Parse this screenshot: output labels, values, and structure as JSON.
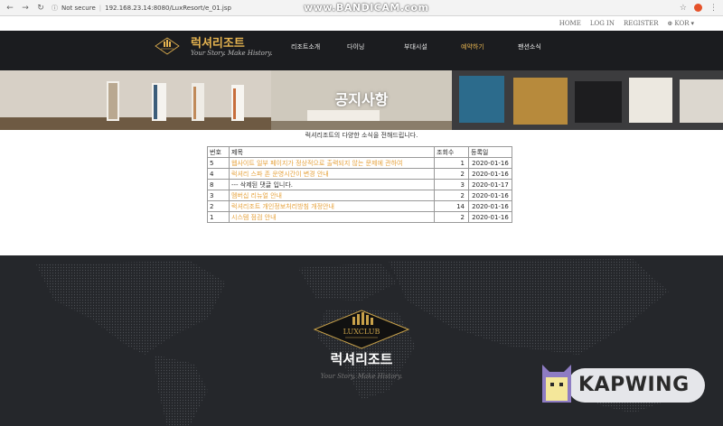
{
  "browser": {
    "security": "Not secure",
    "url": "192.168.23.14:8080/LuxResort/e_01.jsp",
    "recorder_watermark": "www.BANDICAM.com"
  },
  "utility_nav": {
    "home": "HOME",
    "login": "LOG IN",
    "register": "REGISTER",
    "language": "KOR"
  },
  "header": {
    "brand": "럭셔리조트",
    "tagline": "Your Story. Make History.",
    "menu": [
      "리조트소개",
      "다이닝",
      "부대시설",
      "예약하기",
      "팬션소식"
    ],
    "active_index": 3
  },
  "hero": {
    "title": "공지사항"
  },
  "notice": {
    "intro": "럭셔리조트의 다양한 소식을 전해드립니다.",
    "columns": [
      "번호",
      "제목",
      "조회수",
      "등록일"
    ],
    "rows": [
      {
        "num": "5",
        "title": "웹사이트 일부 페이지가 정상적으로 출력되지 않는 문제에 관하여",
        "views": "1",
        "date": "2020-01-16",
        "deleted": false
      },
      {
        "num": "4",
        "title": "럭셔리 스파 존 운영시간이 변경 안내",
        "views": "2",
        "date": "2020-01-16",
        "deleted": false
      },
      {
        "num": "8",
        "title": "--- 삭제된 댓글 입니다.",
        "views": "3",
        "date": "2020-01-17",
        "deleted": true
      },
      {
        "num": "3",
        "title": "멤버십 리뉴얼 안내",
        "views": "2",
        "date": "2020-01-16",
        "deleted": false
      },
      {
        "num": "2",
        "title": "럭셔리조트 개인정보처리방침 개정안내",
        "views": "14",
        "date": "2020-01-16",
        "deleted": false
      },
      {
        "num": "1",
        "title": "시스템 점검 안내",
        "views": "2",
        "date": "2020-01-16",
        "deleted": false
      }
    ]
  },
  "footer": {
    "logo_text": "LUXCLUB",
    "brand": "럭셔리조트",
    "tagline": "Your Story. Make History."
  },
  "watermark": {
    "text": "KAPWING"
  },
  "colors": {
    "accent_gold": "#e6b450",
    "header_bg": "#1b1c1f",
    "footer_bg": "#25272b"
  }
}
